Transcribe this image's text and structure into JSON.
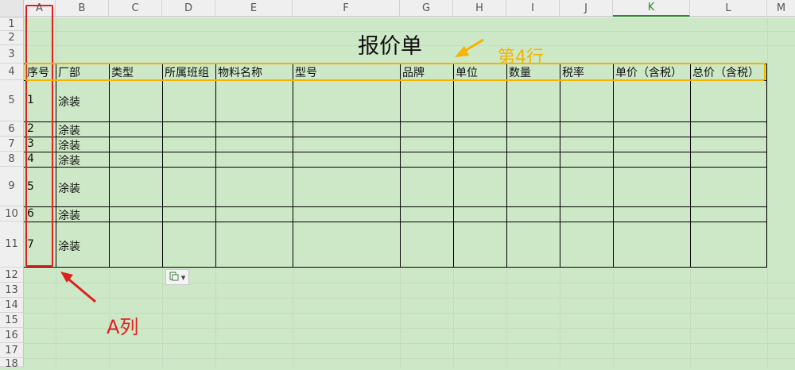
{
  "columns": [
    "A",
    "B",
    "C",
    "D",
    "E",
    "F",
    "G",
    "H",
    "I",
    "J",
    "K",
    "L",
    "M"
  ],
  "selected_column": "K",
  "rows": [
    "1",
    "2",
    "3",
    "4",
    "5",
    "6",
    "7",
    "8",
    "9",
    "10",
    "11",
    "12",
    "13",
    "14",
    "15",
    "16",
    "17",
    "18"
  ],
  "title": "报价单",
  "headers": [
    "序号",
    "厂部",
    "类型",
    "所属班组",
    "物料名称",
    "型号",
    "品牌",
    "单位",
    "数量",
    "税率",
    "单价（含税）",
    "总价（含税）"
  ],
  "data_rows": [
    {
      "no": "1",
      "dept": "涂装"
    },
    {
      "no": "2",
      "dept": "涂装"
    },
    {
      "no": "3",
      "dept": "涂装"
    },
    {
      "no": "4",
      "dept": "涂装"
    },
    {
      "no": "5",
      "dept": "涂装"
    },
    {
      "no": "6",
      "dept": "涂装"
    },
    {
      "no": "7",
      "dept": "涂装"
    }
  ],
  "annotations": {
    "row_label": "第4行",
    "col_label": "A列",
    "row_color": "#f4b400",
    "col_color": "#e02020"
  },
  "paste_options_icon": "paste-options-icon"
}
